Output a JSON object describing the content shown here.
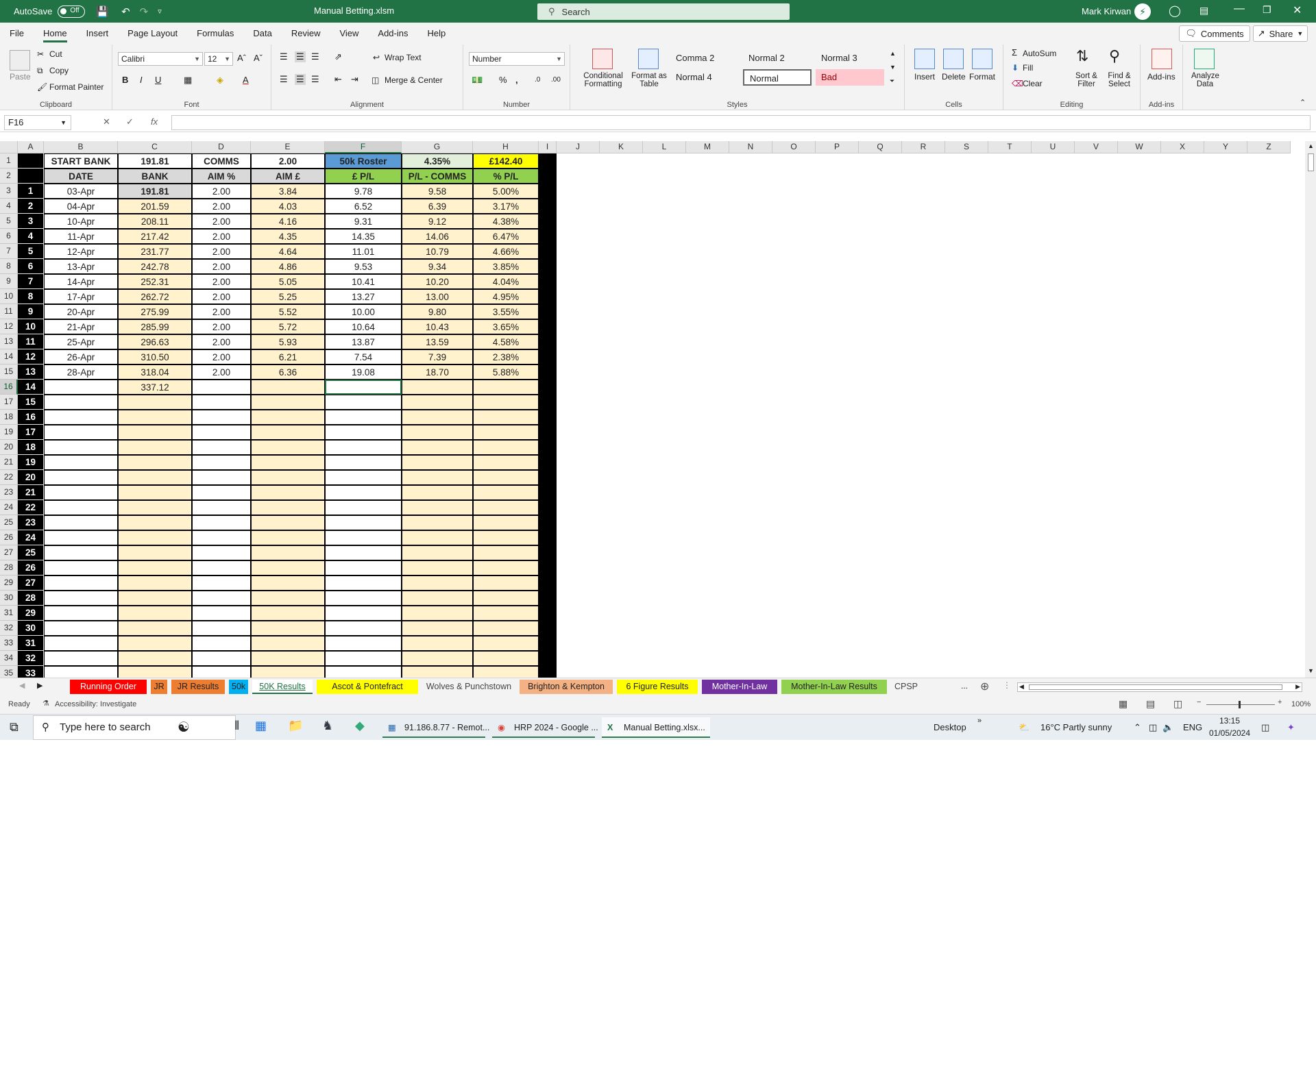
{
  "titlebar": {
    "autosave_label": "AutoSave",
    "toggle_state": "Off",
    "filename": "Manual Betting.xlsm",
    "search_placeholder": "Search",
    "user": "Mark Kirwan"
  },
  "menu": [
    "File",
    "Home",
    "Insert",
    "Page Layout",
    "Formulas",
    "Data",
    "Review",
    "View",
    "Add-ins",
    "Help"
  ],
  "menu_active": "Home",
  "comments_label": "Comments",
  "share_label": "Share",
  "ribbon": {
    "clipboard": {
      "paste": "Paste",
      "cut": "Cut",
      "copy": "Copy",
      "format_painter": "Format Painter",
      "label": "Clipboard"
    },
    "font": {
      "name": "Calibri",
      "size": "12",
      "bold": "B",
      "italic": "I",
      "underline": "U",
      "label": "Font"
    },
    "alignment": {
      "wrap": "Wrap Text",
      "merge": "Merge & Center",
      "label": "Alignment"
    },
    "number": {
      "format": "Number",
      "label": "Number"
    },
    "styles": {
      "conditional": "Conditional Formatting",
      "format_table": "Format as Table",
      "cells": [
        "Comma 2",
        "Normal 2",
        "Normal 3",
        "Normal 4",
        "Normal",
        "Bad"
      ],
      "label": "Styles"
    },
    "cells": {
      "insert": "Insert",
      "delete": "Delete",
      "format": "Format",
      "label": "Cells"
    },
    "editing": {
      "autosum": "AutoSum",
      "fill": "Fill",
      "clear": "Clear",
      "sort": "Sort & Filter",
      "find": "Find & Select",
      "label": "Editing"
    },
    "addins": {
      "addins": "Add-ins",
      "label": "Add-ins"
    },
    "analyze": {
      "label": "Analyze Data"
    }
  },
  "formula_bar": {
    "name_box": "F16",
    "fx": "fx",
    "value": ""
  },
  "columns": [
    "A",
    "B",
    "C",
    "D",
    "E",
    "F",
    "G",
    "H",
    "I",
    "J",
    "K",
    "L",
    "M",
    "N",
    "O",
    "P",
    "Q",
    "R",
    "S",
    "T",
    "U",
    "V",
    "W",
    "X",
    "Y",
    "Z"
  ],
  "selected_column": "F",
  "selected_row": "16",
  "row_numbers": [
    "1",
    "2",
    "3",
    "4",
    "5",
    "6",
    "7",
    "8",
    "9",
    "10",
    "11",
    "12",
    "13",
    "14",
    "15",
    "16",
    "17",
    "18",
    "19",
    "20",
    "21",
    "22",
    "23",
    "24",
    "25",
    "26",
    "27",
    "28",
    "29",
    "30",
    "31",
    "32",
    "33",
    "34",
    "35"
  ],
  "sheet": {
    "row1": {
      "b": "START BANK",
      "c": "191.81",
      "d": "COMMS",
      "e": "2.00",
      "f": "50k Roster",
      "g": "4.35%",
      "h": "£142.40"
    },
    "row2": {
      "b": "DATE",
      "c": "BANK",
      "d": "AIM %",
      "e": "AIM £",
      "f": "£ P/L",
      "g": "P/L - COMMS",
      "h": "% P/L"
    },
    "data_rows": [
      [
        "1",
        "03-Apr",
        "191.81",
        "2.00",
        "3.84",
        "9.78",
        "9.58",
        "5.00%"
      ],
      [
        "2",
        "04-Apr",
        "201.59",
        "2.00",
        "4.03",
        "6.52",
        "6.39",
        "3.17%"
      ],
      [
        "3",
        "10-Apr",
        "208.11",
        "2.00",
        "4.16",
        "9.31",
        "9.12",
        "4.38%"
      ],
      [
        "4",
        "11-Apr",
        "217.42",
        "2.00",
        "4.35",
        "14.35",
        "14.06",
        "6.47%"
      ],
      [
        "5",
        "12-Apr",
        "231.77",
        "2.00",
        "4.64",
        "11.01",
        "10.79",
        "4.66%"
      ],
      [
        "6",
        "13-Apr",
        "242.78",
        "2.00",
        "4.86",
        "9.53",
        "9.34",
        "3.85%"
      ],
      [
        "7",
        "14-Apr",
        "252.31",
        "2.00",
        "5.05",
        "10.41",
        "10.20",
        "4.04%"
      ],
      [
        "8",
        "17-Apr",
        "262.72",
        "2.00",
        "5.25",
        "13.27",
        "13.00",
        "4.95%"
      ],
      [
        "9",
        "20-Apr",
        "275.99",
        "2.00",
        "5.52",
        "10.00",
        "9.80",
        "3.55%"
      ],
      [
        "10",
        "21-Apr",
        "285.99",
        "2.00",
        "5.72",
        "10.64",
        "10.43",
        "3.65%"
      ],
      [
        "11",
        "25-Apr",
        "296.63",
        "2.00",
        "5.93",
        "13.87",
        "13.59",
        "4.58%"
      ],
      [
        "12",
        "26-Apr",
        "310.50",
        "2.00",
        "6.21",
        "7.54",
        "7.39",
        "2.38%"
      ],
      [
        "13",
        "28-Apr",
        "318.04",
        "2.00",
        "6.36",
        "19.08",
        "18.70",
        "5.88%"
      ],
      [
        "14",
        "",
        "337.12",
        "",
        "",
        "",
        "",
        ""
      ],
      [
        "15",
        "",
        "",
        "",
        "",
        "",
        "",
        ""
      ],
      [
        "16",
        "",
        "",
        "",
        "",
        "",
        "",
        ""
      ],
      [
        "17",
        "",
        "",
        "",
        "",
        "",
        "",
        ""
      ],
      [
        "18",
        "",
        "",
        "",
        "",
        "",
        "",
        ""
      ],
      [
        "19",
        "",
        "",
        "",
        "",
        "",
        "",
        ""
      ],
      [
        "20",
        "",
        "",
        "",
        "",
        "",
        "",
        ""
      ],
      [
        "21",
        "",
        "",
        "",
        "",
        "",
        "",
        ""
      ],
      [
        "22",
        "",
        "",
        "",
        "",
        "",
        "",
        ""
      ],
      [
        "23",
        "",
        "",
        "",
        "",
        "",
        "",
        ""
      ],
      [
        "24",
        "",
        "",
        "",
        "",
        "",
        "",
        ""
      ],
      [
        "25",
        "",
        "",
        "",
        "",
        "",
        "",
        ""
      ],
      [
        "26",
        "",
        "",
        "",
        "",
        "",
        "",
        ""
      ],
      [
        "27",
        "",
        "",
        "",
        "",
        "",
        "",
        ""
      ],
      [
        "28",
        "",
        "",
        "",
        "",
        "",
        "",
        ""
      ],
      [
        "29",
        "",
        "",
        "",
        "",
        "",
        "",
        ""
      ],
      [
        "30",
        "",
        "",
        "",
        "",
        "",
        "",
        ""
      ],
      [
        "31",
        "",
        "",
        "",
        "",
        "",
        "",
        ""
      ],
      [
        "32",
        "",
        "",
        "",
        "",
        "",
        "",
        ""
      ],
      [
        "33",
        "",
        "",
        "",
        "",
        "",
        "",
        ""
      ]
    ]
  },
  "sheet_tabs": [
    {
      "label": "Running Order",
      "bg": "#ff0000",
      "fg": "#ffffff"
    },
    {
      "label": "JR",
      "bg": "#ed7d31",
      "fg": "#222222"
    },
    {
      "label": "JR Results",
      "bg": "#ed7d31",
      "fg": "#222222"
    },
    {
      "label": "50k",
      "bg": "#00b0f0",
      "fg": "#222222"
    },
    {
      "label": "50K Results",
      "bg": "#ffffff",
      "fg": "#217346",
      "active": true
    },
    {
      "label": "Ascot & Pontefract",
      "bg": "#ffff00",
      "fg": "#222222"
    },
    {
      "label": "Wolves & Punchstown",
      "bg": "#f3f3f3",
      "fg": "#444444"
    },
    {
      "label": "Brighton & Kempton",
      "bg": "#f4b183",
      "fg": "#222222"
    },
    {
      "label": "6 Figure Results",
      "bg": "#ffff00",
      "fg": "#222222"
    },
    {
      "label": "Mother-In-Law",
      "bg": "#7030a0",
      "fg": "#ffffff"
    },
    {
      "label": "Mother-In-Law Results",
      "bg": "#92d050",
      "fg": "#222222"
    },
    {
      "label": "CPSP",
      "bg": "#f3f3f3",
      "fg": "#444444"
    }
  ],
  "sheet_more": "...",
  "status": {
    "ready": "Ready",
    "accessibility": "Accessibility: Investigate",
    "zoom": "100%"
  },
  "taskbar": {
    "search_placeholder": "Type here to search",
    "apps": [
      "91.186.8.77 - Remot...",
      "HRP 2024 - Google ...",
      "Manual Betting.xlsx..."
    ],
    "desktop": "Desktop",
    "weather": "16°C  Partly sunny",
    "lang": "ENG",
    "time": "13:15",
    "date": "01/05/2024"
  }
}
